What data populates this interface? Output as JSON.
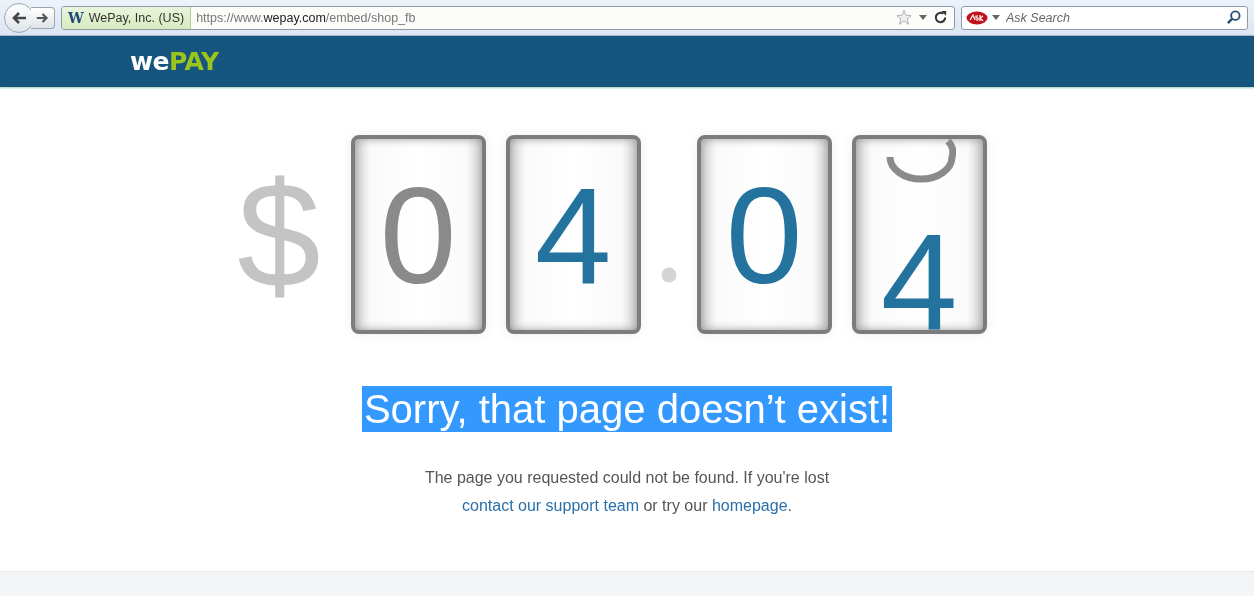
{
  "browser": {
    "favicon": "W",
    "identity": "WePay, Inc. (US)",
    "url": {
      "prefix": "https://www.",
      "domain": "wepay.com",
      "path": "/embed/shop_fb"
    },
    "search": {
      "placeholder": "Ask Search"
    }
  },
  "header": {
    "logo": {
      "first": "we",
      "second": "PAY"
    }
  },
  "counter": {
    "currency": "$",
    "digits": [
      {
        "text": "0",
        "color": "#8a8a8a",
        "rolling": false
      },
      {
        "text": "4",
        "color": "#23739e",
        "rolling": false
      },
      {
        "kind": "separator"
      },
      {
        "text": "0",
        "color": "#23739e",
        "rolling": false
      },
      {
        "text": "4",
        "color": "#23739e",
        "rolling": true
      }
    ]
  },
  "heading": {
    "text": "Sorry, that page doesn’t exist!",
    "selected": true
  },
  "message": [
    {
      "kind": "text",
      "text": "The page you requested could not be found. If you're lost "
    },
    {
      "kind": "link",
      "text": "contact our support team"
    },
    {
      "kind": "text",
      "text": " or try our "
    },
    {
      "kind": "link",
      "text": "homepage"
    },
    {
      "kind": "text",
      "text": "."
    }
  ]
}
